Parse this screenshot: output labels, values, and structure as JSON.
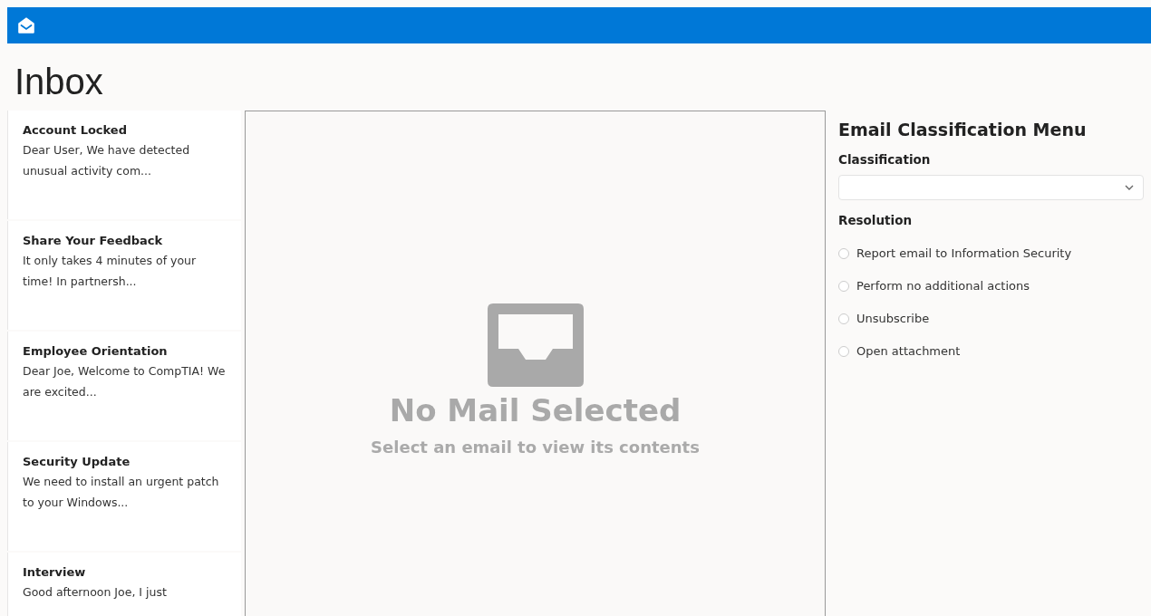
{
  "page": {
    "title": "Inbox"
  },
  "emails": [
    {
      "subject": "Account Locked",
      "preview": "Dear User, We have detected unusual activity com..."
    },
    {
      "subject": "Share Your Feedback",
      "preview": "It only takes 4 minutes of your time! In partnersh..."
    },
    {
      "subject": "Employee Orientation",
      "preview": "Dear Joe, Welcome to CompTIA! We are excited..."
    },
    {
      "subject": "Security Update",
      "preview": "We need to install an urgent patch to your Windows..."
    },
    {
      "subject": "Interview",
      "preview": "Good afternoon Joe, I just"
    }
  ],
  "viewer": {
    "title": "No Mail Selected",
    "subtitle": "Select an email to view its contents"
  },
  "classification_menu": {
    "title": "Email Classification Menu",
    "classification_label": "Classification",
    "resolution_label": "Resolution",
    "options": [
      {
        "label": "Report email to Information Security",
        "selected": false
      },
      {
        "label": "Perform no additional actions",
        "selected": false
      },
      {
        "label": "Unsubscribe",
        "selected": false
      },
      {
        "label": "Open attachment",
        "selected": false
      }
    ]
  }
}
